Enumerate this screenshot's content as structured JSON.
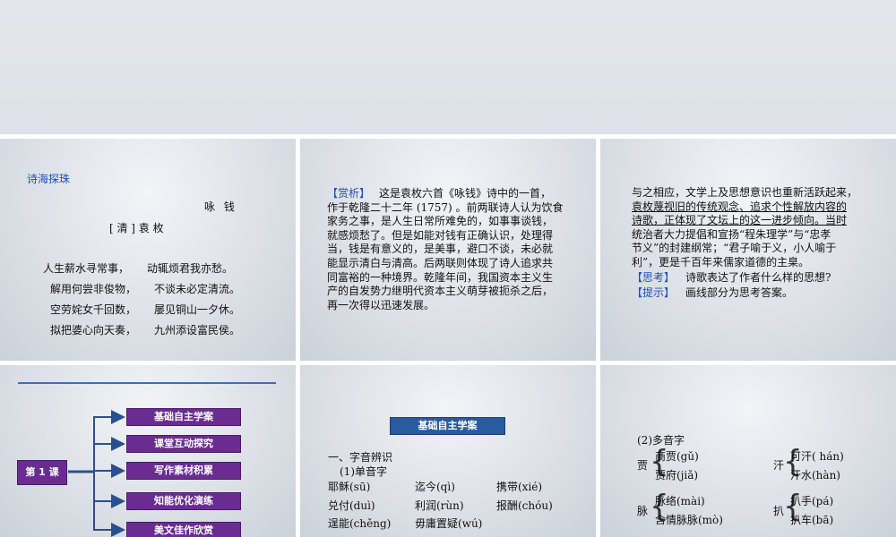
{
  "slide1": {
    "heading": "诗海探珠",
    "poem_title": "咏 钱",
    "author": "[ 清 ] 袁 枚",
    "lines": [
      [
        "人生薪水寻常事，",
        "动辄烦君我亦愁。"
      ],
      [
        "解用何尝非俊物，",
        "不谈未必定清流。"
      ],
      [
        "空劳姹女千回数，",
        "屡见铜山一夕休。"
      ],
      [
        "拟把婆心向天奏，",
        "九州添设富民侯。"
      ]
    ]
  },
  "slide2": {
    "tag": "【赏析】",
    "lines": [
      "这是袁枚六首《咏钱》诗中的一首，",
      "作于乾隆二十二年 (1757) 。前两联诗人认为饮食",
      "家务之事，是人生日常所难免的，如事事谈钱，",
      "就感烦愁了。但是如能对钱有正确认识，处理得",
      "当，钱是有意义的，是美事，避口不谈，未必就",
      "能显示清白与清高。后两联则体现了诗人追求共",
      "同富裕的一种境界。乾隆年间，我国资本主义生",
      "产的自发势力继明代资本主义萌芽被扼杀之后，",
      "再一次得以迅速发展。"
    ]
  },
  "slide3": {
    "lines": [
      "与之相应，文学上及思想意识也重新活跃起来，",
      "袁枚蔑视旧的传统观念、追求个性解放内容的",
      "诗歌，正体现了文坛上的这一进步倾向。当时",
      "统治者大力提倡和宣扬“程朱理学”与“忠孝",
      "节义”的封建纲常；“君子喻于义，小人喻于",
      "利”，更是千百年来儒家道德的主臬。"
    ],
    "think_tag": "【思考】",
    "think_text": "诗歌表达了作者什么样的思想?",
    "hint_tag": "【提示】",
    "hint_text": "画线部分为思考答案。"
  },
  "slide4": {
    "root": "第 1 课",
    "nodes": [
      "基础自主学案",
      "课堂互动探究",
      "写作素材积累",
      "知能优化演练",
      "美文佳作欣赏"
    ]
  },
  "slide5": {
    "banner": "基础自主学案",
    "section": "一、字音辨识",
    "subsection": "(1)单音字",
    "rows": [
      [
        "耶稣(sū)",
        "迄今(qì)",
        "携带(xié)"
      ],
      [
        "兑付(duì)",
        "利润(rùn)",
        "报酬(chóu)"
      ],
      [
        "逞能(chěng)",
        "毋庸置疑(wú)",
        ""
      ]
    ]
  },
  "slide6": {
    "title": "(2)多音字",
    "groups": [
      {
        "char": "贾",
        "items": [
          "商贾(gǔ)",
          "贾府(jiǎ)"
        ]
      },
      {
        "char": "汗",
        "items": [
          "可汗( hán)",
          "汗水(hàn)"
        ]
      },
      {
        "char": "脉",
        "items": [
          "脉络(mài)",
          "含情脉脉(mò)"
        ]
      },
      {
        "char": "扒",
        "items": [
          "扒手(pá)",
          "扒车(bā)"
        ]
      }
    ]
  },
  "colors": {
    "accent_blue": "#1f4fb5",
    "node_purple": "#6a2c91",
    "banner_blue": "#2a5a9f"
  }
}
